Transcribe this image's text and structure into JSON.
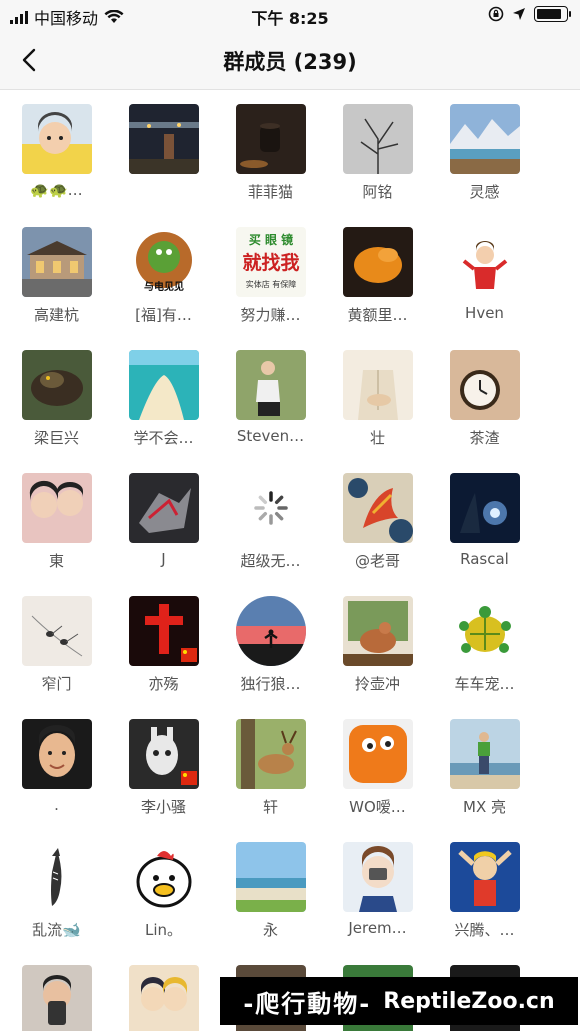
{
  "status_bar": {
    "carrier": "中国移动",
    "time": "下午 8:25"
  },
  "nav": {
    "title": "群成员 (239)"
  },
  "members": [
    "🐢🐢…",
    "",
    "菲菲猫",
    "阿铭",
    "灵感",
    "高建杭",
    "[福]有…",
    "努力赚…",
    "黄额里…",
    "Hven",
    "梁巨兴",
    "学不会…",
    "Steven…",
    "壮",
    "茶渣",
    "東",
    "J",
    "超级无…",
    "@老哥",
    "Rascal",
    "窄门",
    "亦殇",
    "独行狼…",
    "拎壶冲",
    "车车宠…",
    ".",
    "李小骚",
    "轩",
    "WO嗳…",
    "MX 亮",
    "乱流🐋",
    "Lin。",
    "永",
    "Jerem…",
    "兴腾、…",
    "",
    "",
    "",
    "",
    ""
  ],
  "avatar_texts": {
    "turtle_badge": "与电见见",
    "ad_top": "买 眼 镜",
    "ad_mid": "就找我",
    "ad_bottom": "实体店 有保障"
  },
  "watermark": {
    "cn": "-爬行動物-",
    "en": "ReptileZoo.cn"
  }
}
